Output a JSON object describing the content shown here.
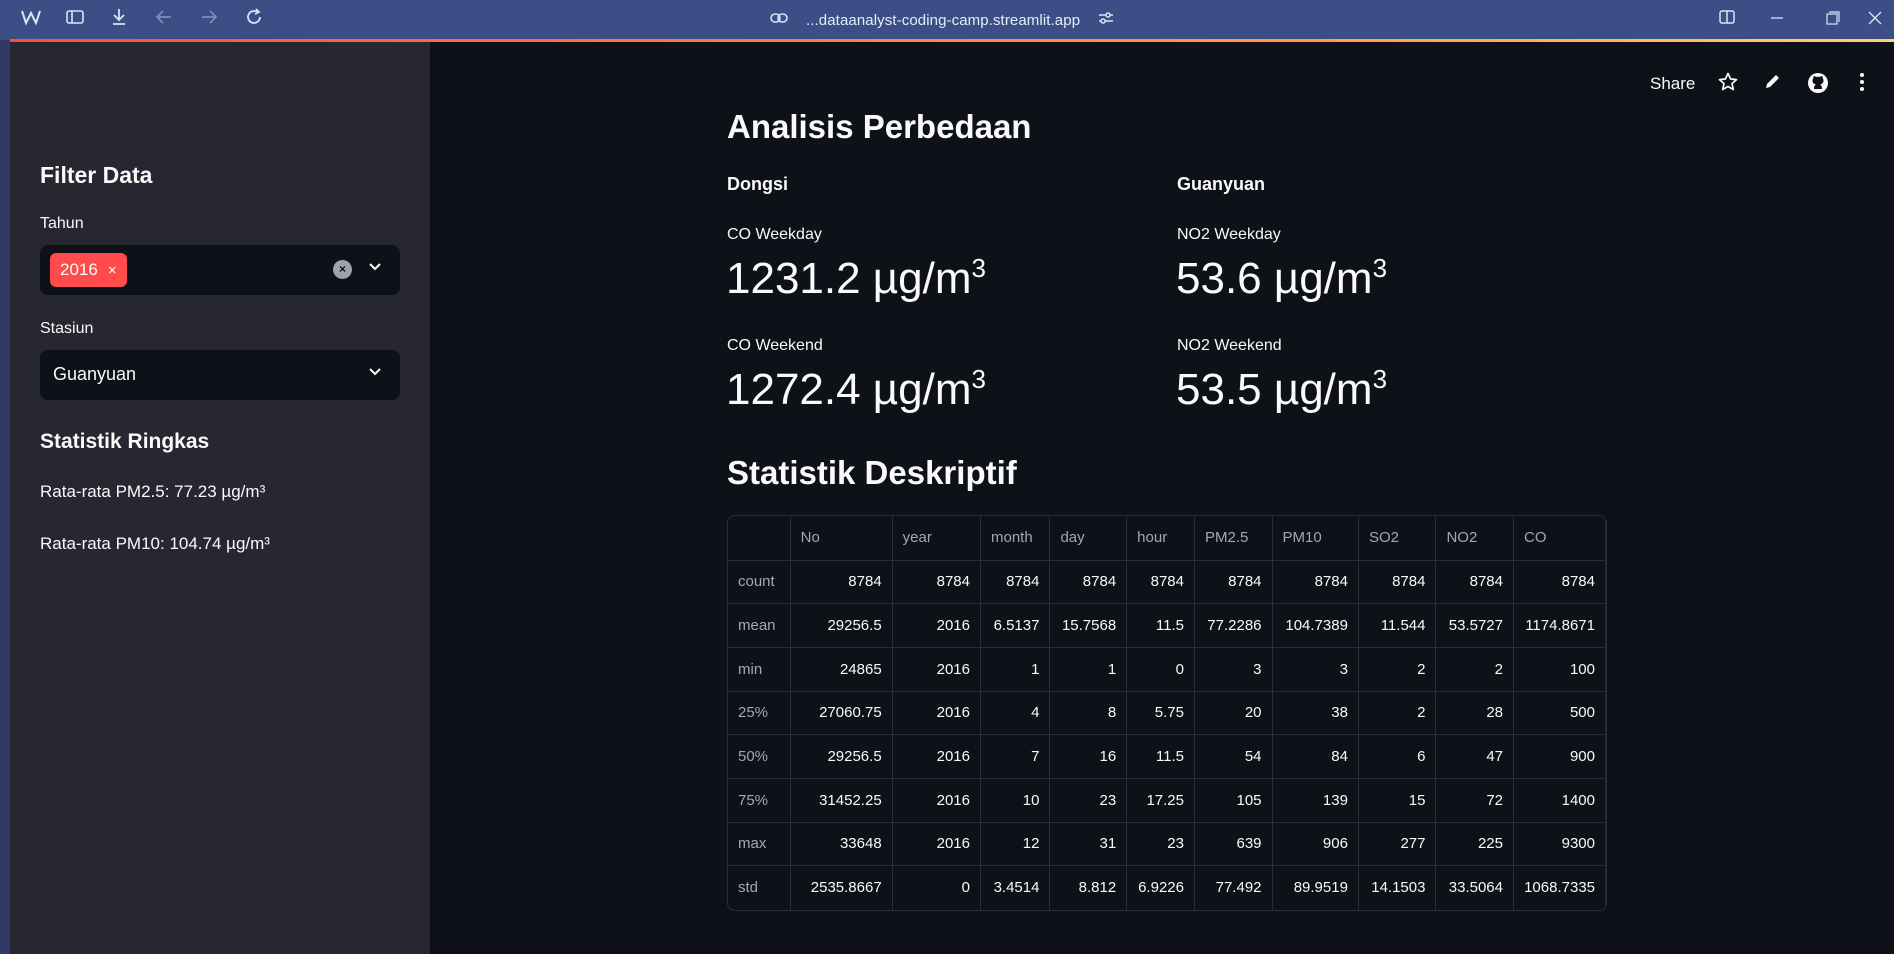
{
  "browser": {
    "url": "...dataanalyst-coding-camp.streamlit.app",
    "icons": [
      "app-logo-icon",
      "sidebar-toggle-icon",
      "download-icon",
      "back-icon",
      "forward-icon",
      "reload-icon",
      "link-icon",
      "site-settings-icon",
      "split-view-icon",
      "minimize-icon",
      "restore-icon",
      "close-icon"
    ]
  },
  "sidebar": {
    "title": "Filter Data",
    "year_label": "Tahun",
    "year_chip": "2016",
    "chip_remove": "×",
    "station_label": "Stasiun",
    "station_value": "Guanyuan",
    "summary_title": "Statistik Ringkas",
    "pm25_avg": "Rata-rata PM2.5: 77.23 µg/m³",
    "pm10_avg": "Rata-rata PM10: 104.74 µg/m³"
  },
  "toolbar": {
    "share_label": "Share"
  },
  "main": {
    "title": "Analisis Perbedaan",
    "left_column": {
      "header": "Dongsi",
      "metric1_label": "CO Weekday",
      "metric1_value": "1231.2 µg/m",
      "metric2_label": "CO Weekend",
      "metric2_value": "1272.4 µg/m"
    },
    "right_column": {
      "header": "Guanyuan",
      "metric1_label": "NO2 Weekday",
      "metric1_value": "53.6 µg/m",
      "metric2_label": "NO2 Weekend",
      "metric2_value": "53.5 µg/m"
    },
    "superscript": "3",
    "section_title": "Statistik Deskriptif"
  },
  "table": {
    "columns": [
      "",
      "No",
      "year",
      "month",
      "day",
      "hour",
      "PM2.5",
      "PM10",
      "SO2",
      "NO2",
      "CO"
    ],
    "rows": [
      [
        "count",
        "8784",
        "8784",
        "8784",
        "8784",
        "8784",
        "8784",
        "8784",
        "8784",
        "8784",
        "8784"
      ],
      [
        "mean",
        "29256.5",
        "2016",
        "6.5137",
        "15.7568",
        "11.5",
        "77.2286",
        "104.7389",
        "11.544",
        "53.5727",
        "1174.8671"
      ],
      [
        "min",
        "24865",
        "2016",
        "1",
        "1",
        "0",
        "3",
        "3",
        "2",
        "2",
        "100"
      ],
      [
        "25%",
        "27060.75",
        "2016",
        "4",
        "8",
        "5.75",
        "20",
        "38",
        "2",
        "28",
        "500"
      ],
      [
        "50%",
        "29256.5",
        "2016",
        "7",
        "16",
        "11.5",
        "54",
        "84",
        "6",
        "47",
        "900"
      ],
      [
        "75%",
        "31452.25",
        "2016",
        "10",
        "23",
        "17.25",
        "105",
        "139",
        "15",
        "72",
        "1400"
      ],
      [
        "max",
        "33648",
        "2016",
        "12",
        "31",
        "23",
        "639",
        "906",
        "277",
        "225",
        "9300"
      ],
      [
        "std",
        "2535.8667",
        "0",
        "3.4514",
        "8.812",
        "6.9226",
        "77.492",
        "89.9519",
        "14.1503",
        "33.5064",
        "1068.7335"
      ]
    ]
  },
  "colors": {
    "accent": "#ff4b4b",
    "background": "#0e1117",
    "sidebar": "#262730",
    "browser_bar": "#3b4f86"
  }
}
